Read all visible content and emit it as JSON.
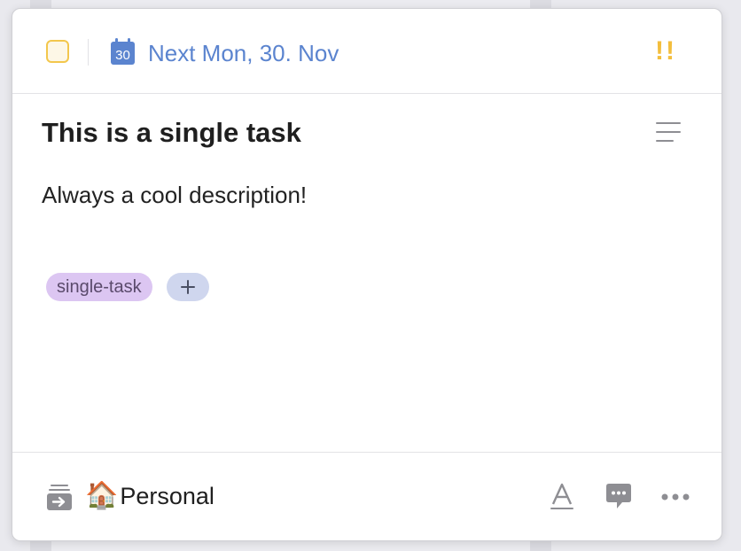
{
  "task": {
    "due_label": "Next Mon, 30. Nov",
    "calendar_day": "30",
    "priority_label": "!!",
    "title": "This is a single task",
    "description": "Always a cool description!",
    "tags": [
      {
        "label": "single-task"
      }
    ],
    "add_tag_label": "+"
  },
  "footer": {
    "project_emoji": "🏠",
    "project_name": "Personal"
  },
  "colors": {
    "priority": "#f3be3d",
    "date_accent": "#5b84cf",
    "checkbox_border": "#f3c74c",
    "tag_bg": "#dcc6f2",
    "add_tag_bg": "#cfd6ee",
    "icon_gray": "#8e8e93"
  },
  "icons": {
    "checkbox": "checkbox-icon",
    "calendar": "calendar-icon",
    "menu": "menu-icon",
    "move": "move-to-icon",
    "project": "house-icon",
    "format": "text-format-icon",
    "comment": "comment-icon",
    "more": "more-icon"
  }
}
